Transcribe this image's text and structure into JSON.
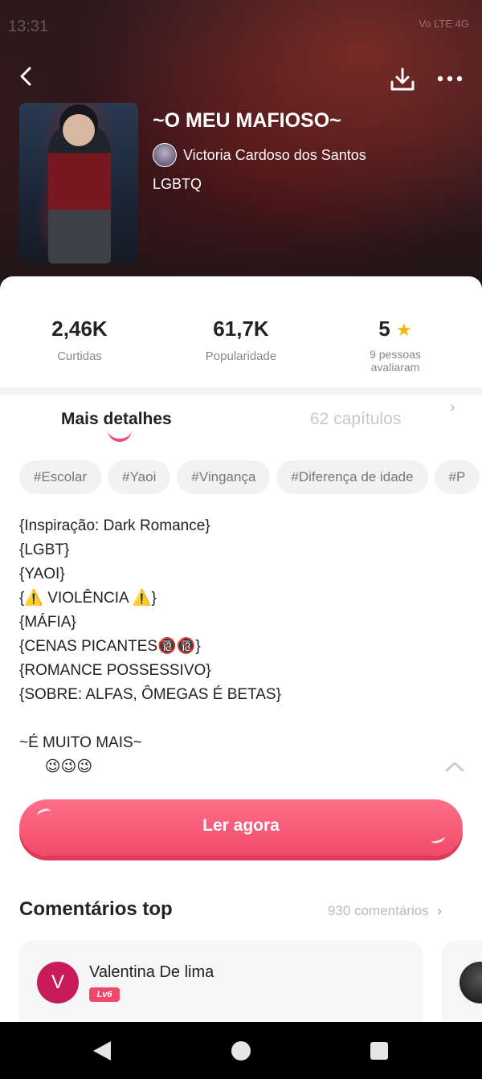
{
  "status_bar": {
    "time": "13:31",
    "network": "Vo LTE 4G"
  },
  "book": {
    "title": "~O MEU MAFIOSO~",
    "author": "Victoria Cardoso dos Santos",
    "genre": "LGBTQ"
  },
  "stats": {
    "likes_value": "2,46K",
    "likes_label": "Curtidas",
    "popularity_value": "61,7K",
    "popularity_label": "Popularidade",
    "rating_value": "5",
    "rating_label": "9 pessoas avaliaram"
  },
  "tabs": {
    "details": "Mais detalhes",
    "chapters": "62 capítulos"
  },
  "tags": [
    "#Escolar",
    "#Yaoi",
    "#Vingança",
    "#Diferença de idade",
    "#P"
  ],
  "description": "{Inspiração: Dark Romance}\n{LGBT}\n{YAOI}\n{⚠️ VIOLÊNCIA ⚠️}\n{MÁFIA}\n{CENAS PICANTES🔞🔞}\n{ROMANCE POSSESSIVO}\n{SOBRE: ALFAS, ÔMEGAS É BETAS}\n\n~É MUITO MAIS~\n      😉😉😉",
  "read_button": "Ler agora",
  "comments": {
    "title": "Comentários top",
    "count_link": "930 comentários",
    "items": [
      {
        "avatar_letter": "V",
        "name": "Valentina De lima",
        "level": "Lv6"
      }
    ]
  },
  "icons": {
    "back": "back-arrow-icon",
    "download": "download-icon",
    "more": "more-icon",
    "star": "star-icon",
    "collapse": "chevron-up-icon"
  },
  "colors": {
    "accent": "#f04a6a",
    "star": "#f6b400"
  }
}
